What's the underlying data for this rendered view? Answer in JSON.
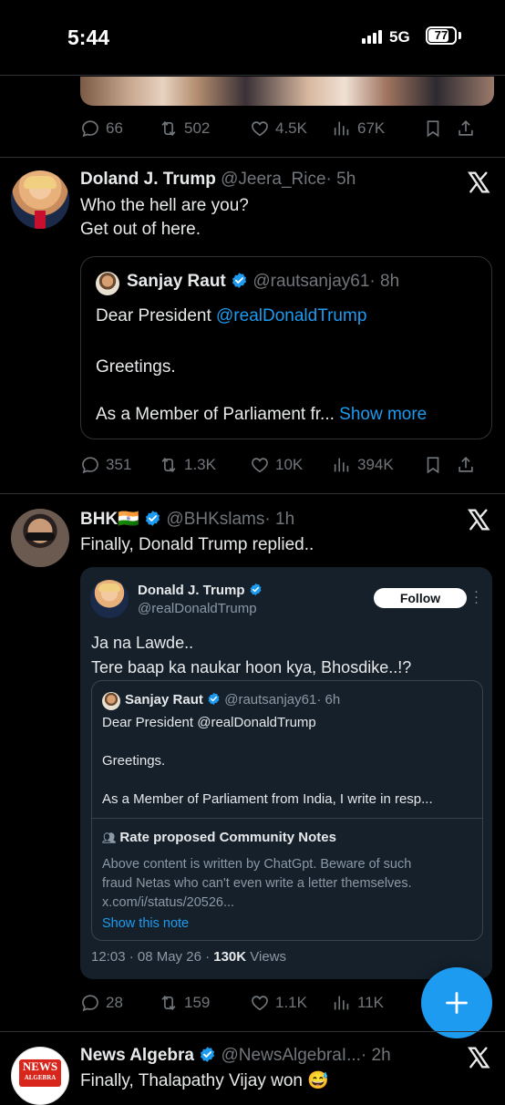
{
  "status_bar": {
    "time": "5:44",
    "network": "5G",
    "battery": "77",
    "battery_level": 0.77
  },
  "tweet0": {
    "replies": "66",
    "reposts": "502",
    "likes": "4.5K",
    "views": "67K"
  },
  "tweet1": {
    "name": "Doland J. Trump",
    "handle": "@Jeera_Rice",
    "time": "· 5h",
    "text_line1": "Who the hell are you?",
    "text_line2": "Get out of here.",
    "quote": {
      "name": "Sanjay Raut",
      "handle": "@rautsanjay61",
      "time": "· 8h",
      "line1_prefix": "Dear President ",
      "mention": "@realDonaldTrump",
      "line2": "Greetings.",
      "line3": "As a Member of Parliament fr...",
      "show_more": "Show more"
    },
    "replies": "351",
    "reposts": "1.3K",
    "likes": "10K",
    "views": "394K"
  },
  "tweet2": {
    "name": "BHK",
    "flag": "🇮🇳",
    "handle": "@BHKslams",
    "time": "· 1h",
    "text": "Finally, Donald Trump replied..",
    "screenshot": {
      "name": "Donald J. Trump",
      "handle": "@realDonaldTrump",
      "follow": "Follow",
      "text_line1": "Ja na Lawde..",
      "text_line2": "Tere baap ka naukar hoon kya, Bhosdike..!?",
      "quote": {
        "name": "Sanjay Raut",
        "handle": "@rautsanjay61",
        "time": "· 6h",
        "line1": "Dear President @realDonaldTrump",
        "line2": "Greetings.",
        "line3": "As a Member of Parliament from India, I write in resp..."
      },
      "note": {
        "title": "Rate proposed Community Notes",
        "line1": "Above content is written by ChatGpt. Beware of such",
        "line2": "fraud Netas who can't even write a letter themselves.",
        "line3": "x.com/i/status/20526...",
        "link": "Show this note"
      },
      "timestamp": "12:03 · 08 May 26 · ",
      "views_count": "130K",
      "views_label": " Views"
    },
    "replies": "28",
    "reposts": "159",
    "likes": "1.1K",
    "views": "11K"
  },
  "tweet3": {
    "name": "News Algebra",
    "handle": "@NewsAlgebraI...",
    "time": "· 2h",
    "text": "Finally, Thalapathy Vijay won",
    "emoji": "😅",
    "avatar_line1": "NEWS",
    "avatar_line2": "ALGEBRA"
  },
  "colors": {
    "accent": "#1d9bf0",
    "background": "#000000",
    "muted": "#71767b",
    "card": "#15202b"
  }
}
